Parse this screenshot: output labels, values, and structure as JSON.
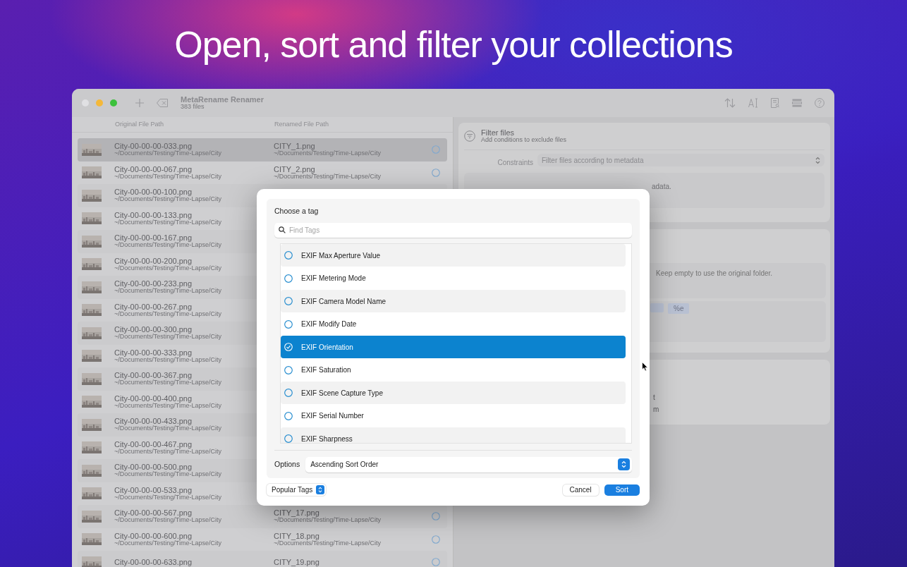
{
  "headline": "Open, sort and filter your collections",
  "window": {
    "title": "MetaRename Renamer",
    "subtitle": "383 files"
  },
  "columns": [
    "Original File Path",
    "Renamed File Path"
  ],
  "files": [
    {
      "name": "City-00-00-00-033.png",
      "path": "~/Documents/Testing/Time-Lapse/City",
      "renamed_name": "CITY_1.png",
      "renamed_path": "~/Documents/Testing/Time-Lapse/City",
      "selected": true
    },
    {
      "name": "City-00-00-00-067.png",
      "path": "~/Documents/Testing/Time-Lapse/City",
      "renamed_name": "CITY_2.png",
      "renamed_path": "~/Documents/Testing/Time-Lapse/City",
      "selected": false
    },
    {
      "name": "City-00-00-00-100.png",
      "path": "~/Documents/Testing/Time-Lapse/City",
      "selected": false
    },
    {
      "name": "City-00-00-00-133.png",
      "path": "~/Documents/Testing/Time-Lapse/City",
      "selected": false
    },
    {
      "name": "City-00-00-00-167.png",
      "path": "~/Documents/Testing/Time-Lapse/City",
      "selected": false
    },
    {
      "name": "City-00-00-00-200.png",
      "path": "~/Documents/Testing/Time-Lapse/City",
      "selected": false
    },
    {
      "name": "City-00-00-00-233.png",
      "path": "~/Documents/Testing/Time-Lapse/City",
      "selected": false
    },
    {
      "name": "City-00-00-00-267.png",
      "path": "~/Documents/Testing/Time-Lapse/City",
      "selected": false
    },
    {
      "name": "City-00-00-00-300.png",
      "path": "~/Documents/Testing/Time-Lapse/City",
      "selected": false
    },
    {
      "name": "City-00-00-00-333.png",
      "path": "~/Documents/Testing/Time-Lapse/City",
      "selected": false
    },
    {
      "name": "City-00-00-00-367.png",
      "path": "~/Documents/Testing/Time-Lapse/City",
      "selected": false
    },
    {
      "name": "City-00-00-00-400.png",
      "path": "~/Documents/Testing/Time-Lapse/City",
      "selected": false
    },
    {
      "name": "City-00-00-00-433.png",
      "path": "~/Documents/Testing/Time-Lapse/City",
      "selected": false
    },
    {
      "name": "City-00-00-00-467.png",
      "path": "~/Documents/Testing/Time-Lapse/City",
      "selected": false
    },
    {
      "name": "City-00-00-00-500.png",
      "path": "~/Documents/Testing/Time-Lapse/City",
      "selected": false
    },
    {
      "name": "City-00-00-00-533.png",
      "path": "~/Documents/Testing/Time-Lapse/City",
      "selected": false
    },
    {
      "name": "City-00-00-00-567.png",
      "path": "~/Documents/Testing/Time-Lapse/City",
      "renamed_name": "CITY_17.png",
      "renamed_path": "~/Documents/Testing/Time-Lapse/City",
      "selected": false
    },
    {
      "name": "City-00-00-00-600.png",
      "path": "~/Documents/Testing/Time-Lapse/City",
      "renamed_name": "CITY_18.png",
      "renamed_path": "~/Documents/Testing/Time-Lapse/City",
      "selected": false
    },
    {
      "name": "City-00-00-00-633.png",
      "renamed_name": "CITY_19.png",
      "selected": false
    }
  ],
  "filter_panel": {
    "title": "Filter files",
    "subtitle": "Add conditions to exclude files",
    "constraints_label": "Constraints",
    "constraints_value": "Filter files according to metadata",
    "field_fragment": "adata."
  },
  "folder_panel": {
    "placeholder": "Keep empty to use the original folder.",
    "tokens": [
      "%e"
    ]
  },
  "options_panel": {
    "fragments": [
      "t",
      "m"
    ]
  },
  "dialog": {
    "heading": "Choose a tag",
    "search_placeholder": "Find Tags",
    "tags": [
      {
        "label": "EXIF Max Aperture Value",
        "selected": false
      },
      {
        "label": "EXIF Metering Mode",
        "selected": false
      },
      {
        "label": "EXIF Camera Model Name",
        "selected": false
      },
      {
        "label": "EXIF Modify Date",
        "selected": false
      },
      {
        "label": "EXIF Orientation",
        "selected": true
      },
      {
        "label": "EXIF Saturation",
        "selected": false
      },
      {
        "label": "EXIF Scene Capture Type",
        "selected": false
      },
      {
        "label": "EXIF Serial Number",
        "selected": false
      },
      {
        "label": "EXIF Sharpness",
        "selected": false
      }
    ],
    "options_label": "Options",
    "options_value": "Ascending Sort Order",
    "popup": "Popular Tags",
    "cancel": "Cancel",
    "confirm": "Sort"
  }
}
